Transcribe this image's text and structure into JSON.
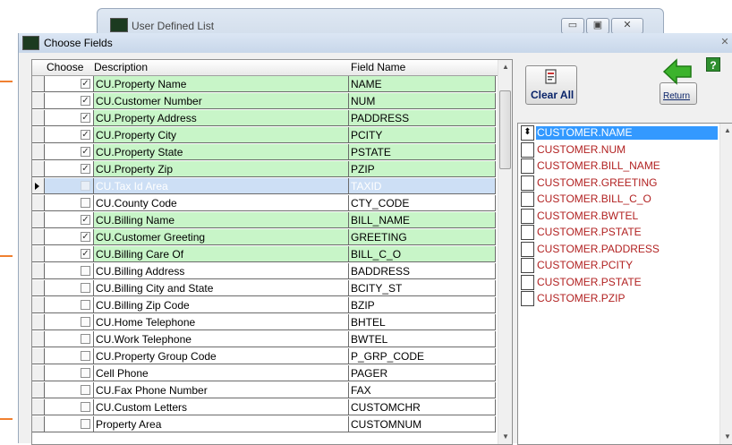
{
  "background_window": {
    "title": "User Defined List",
    "min_label": "▭",
    "max_label": "▣",
    "close_label": "✕"
  },
  "dialog": {
    "title": "Choose Fields",
    "close_label": "✕"
  },
  "grid": {
    "headers": {
      "choose": "Choose",
      "description": "Description",
      "field_name": "Field Name"
    },
    "rows": [
      {
        "checked": true,
        "selected": false,
        "description": "CU.Property Name",
        "field": "NAME"
      },
      {
        "checked": true,
        "selected": false,
        "description": "CU.Customer Number",
        "field": "NUM"
      },
      {
        "checked": true,
        "selected": false,
        "description": "CU.Property Address",
        "field": "PADDRESS"
      },
      {
        "checked": true,
        "selected": false,
        "description": "CU.Property City",
        "field": "PCITY"
      },
      {
        "checked": true,
        "selected": false,
        "description": "CU.Property State",
        "field": "PSTATE"
      },
      {
        "checked": true,
        "selected": false,
        "description": "CU.Property Zip",
        "field": "PZIP"
      },
      {
        "checked": false,
        "selected": true,
        "description": "CU.Tax Id Area",
        "field": "TAXID"
      },
      {
        "checked": false,
        "selected": false,
        "description": "CU.County Code",
        "field": "CTY_CODE"
      },
      {
        "checked": true,
        "selected": false,
        "description": "CU.Billing Name",
        "field": "BILL_NAME"
      },
      {
        "checked": true,
        "selected": false,
        "description": "CU.Customer Greeting",
        "field": "GREETING"
      },
      {
        "checked": true,
        "selected": false,
        "description": "CU.Billing Care Of",
        "field": "BILL_C_O"
      },
      {
        "checked": false,
        "selected": false,
        "description": "CU.Billing Address",
        "field": "BADDRESS"
      },
      {
        "checked": false,
        "selected": false,
        "description": "CU.Billing City and State",
        "field": "BCITY_ST"
      },
      {
        "checked": false,
        "selected": false,
        "description": "CU.Billing Zip Code",
        "field": "BZIP"
      },
      {
        "checked": false,
        "selected": false,
        "description": "CU.Home Telephone",
        "field": "BHTEL"
      },
      {
        "checked": false,
        "selected": false,
        "description": "CU.Work Telephone",
        "field": "BWTEL"
      },
      {
        "checked": false,
        "selected": false,
        "description": "CU.Property Group Code",
        "field": "P_GRP_CODE"
      },
      {
        "checked": false,
        "selected": false,
        "description": "Cell Phone",
        "field": "PAGER"
      },
      {
        "checked": false,
        "selected": false,
        "description": "CU.Fax Phone Number",
        "field": "FAX"
      },
      {
        "checked": false,
        "selected": false,
        "description": "CU.Custom Letters",
        "field": "CUSTOMCHR"
      },
      {
        "checked": false,
        "selected": false,
        "description": "Property Area",
        "field": "CUSTOMNUM"
      }
    ]
  },
  "toolbar": {
    "clear_all_label": "Clear All",
    "return_label": "Return",
    "help_label": "?"
  },
  "selected_list": {
    "items": [
      "CUSTOMER.NAME",
      "CUSTOMER.NUM",
      "CUSTOMER.BILL_NAME",
      "CUSTOMER.GREETING",
      "CUSTOMER.BILL_C_O",
      "CUSTOMER.BWTEL",
      "CUSTOMER.PSTATE",
      "CUSTOMER.PADDRESS",
      "CUSTOMER.PCITY",
      "CUSTOMER.PSTATE",
      "CUSTOMER.PZIP"
    ],
    "active_index": 0,
    "reorder_glyph": "⬍"
  },
  "colors": {
    "checked_row": "#c8f5c8",
    "selected_row": "#cddff5",
    "list_text": "#b22222",
    "list_highlight": "#3399ff",
    "return_arrow": "#33aa22",
    "help_button": "#2f8f2f"
  }
}
